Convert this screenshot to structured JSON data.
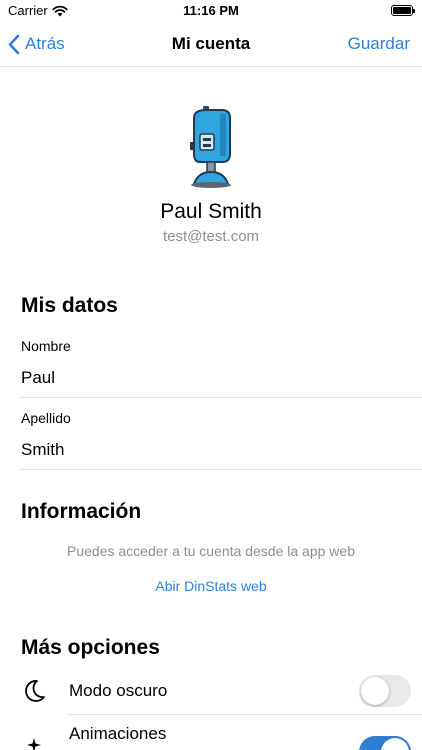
{
  "status_bar": {
    "carrier": "Carrier",
    "time": "11:16 PM"
  },
  "nav": {
    "back_label": "Atrás",
    "title": "Mi cuenta",
    "save_label": "Guardar"
  },
  "profile": {
    "name": "Paul Smith",
    "email": "test@test.com"
  },
  "mis_datos": {
    "title": "Mis datos",
    "first_name_label": "Nombre",
    "first_name_value": "Paul",
    "last_name_label": "Apellido",
    "last_name_value": "Smith"
  },
  "informacion": {
    "title": "Información",
    "text": "Puedes acceder a tu cuenta desde la app web",
    "link": "Abir DinStats web"
  },
  "mas_opciones": {
    "title": "Más opciones",
    "options": [
      {
        "label": "Modo oscuro",
        "icon": "moon-icon",
        "enabled": false
      },
      {
        "label": "Animaciones",
        "icon": "sparkles-icon",
        "enabled": true
      }
    ]
  },
  "colors": {
    "accent": "#2f7fd7",
    "secondary_text": "#8e8e93",
    "separator": "#e4e4e6"
  }
}
